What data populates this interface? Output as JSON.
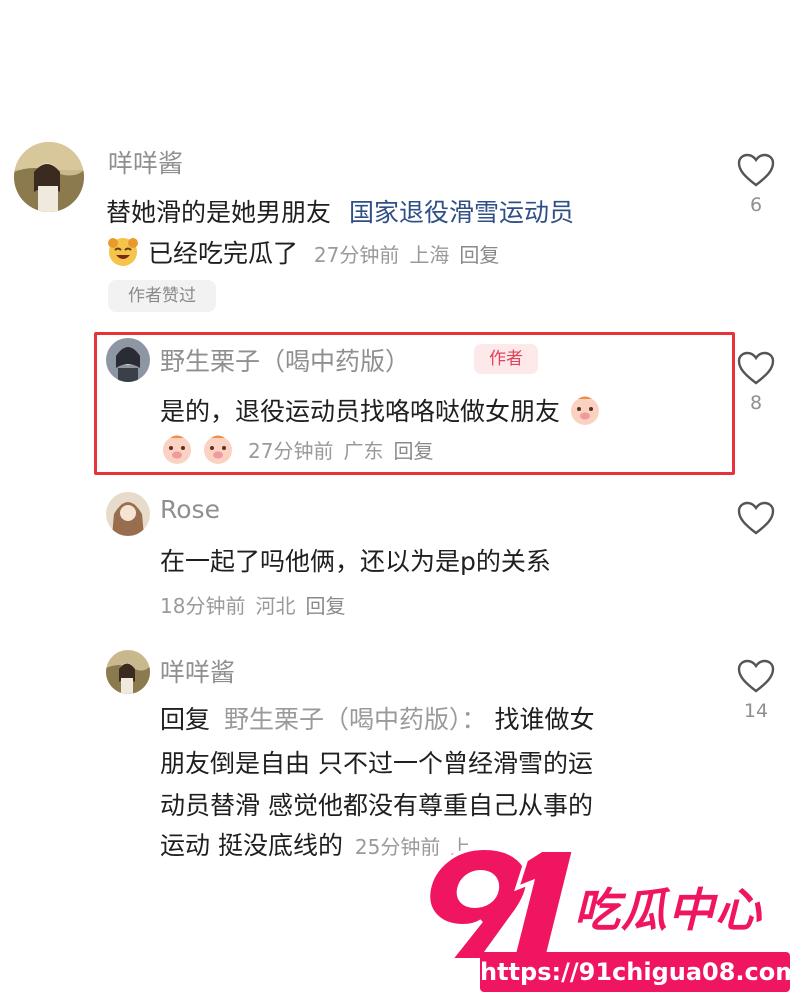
{
  "comments": [
    {
      "username": "咩咩酱",
      "text_line1": "替她滑的是她男朋友",
      "link": "国家退役滑雪运动员",
      "text_line2": "已经吃完瓜了",
      "time": "27分钟前",
      "location": "上海",
      "reply": "回复",
      "likes": "6",
      "liked_by_author": "作者赞过"
    },
    {
      "username": "野生栗子（喝中药版）",
      "author_tag": "作者",
      "text": "是的，退役运动员找咯咯哒做女朋友",
      "time": "27分钟前",
      "location": "广东",
      "reply": "回复",
      "likes": "8"
    },
    {
      "username": "Rose",
      "text": "在一起了吗他俩，还以为是p的关系",
      "time": "18分钟前",
      "location": "河北",
      "reply": "回复",
      "likes": ""
    },
    {
      "username": "咩咩酱",
      "reply_prefix": "回复",
      "reply_to": "野生栗子（喝中药版）：",
      "text_line1_rest": "找谁做女",
      "text_line2": "朋友倒是自由 只不过一个曾经滑雪的运",
      "text_line3": "动员替滑 感觉他都没有尊重自己从事的",
      "text_line4": "运动 挺没底线的",
      "time": "25分钟前",
      "location": "上",
      "likes": "14"
    }
  ],
  "watermark": {
    "number": "91",
    "brand": "吃瓜中心",
    "url": "https://91chigua08.com"
  },
  "colors": {
    "highlight_border": "#e8323a",
    "author_tag_text": "#e0435a",
    "link": "#2f4f86",
    "watermark": "#f01561"
  },
  "icons": [
    "heart-outline-icon",
    "laughing-emoji-icon",
    "pig-face-emoji-icon"
  ]
}
